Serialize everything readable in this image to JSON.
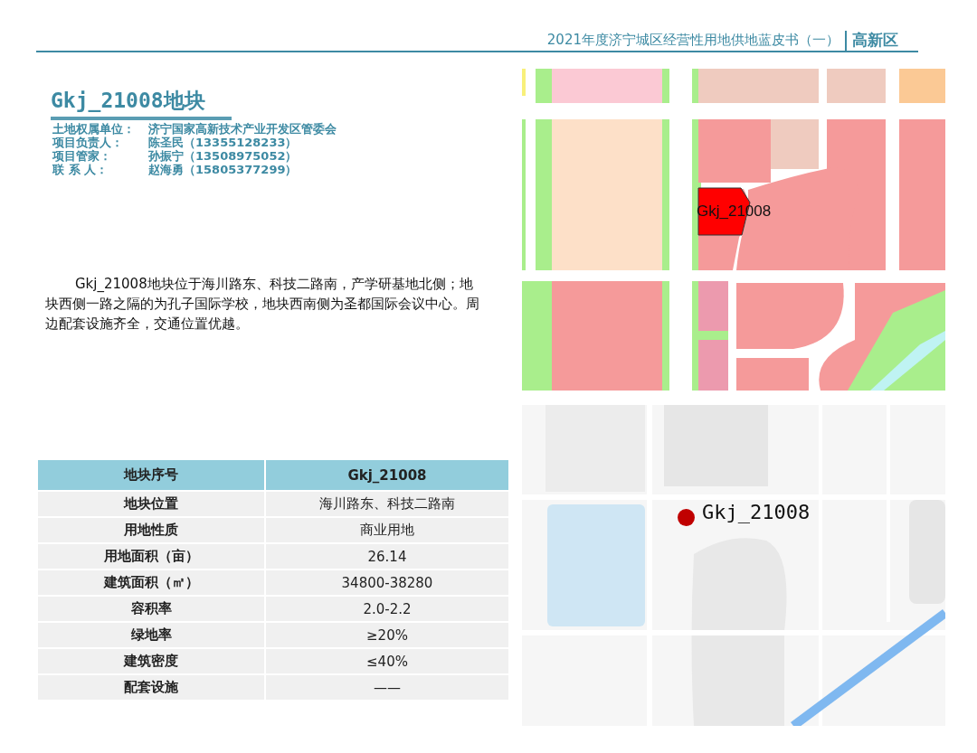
{
  "header": {
    "title": "2021年度济宁城区经营性用地供地蓝皮书（一）",
    "district": "高新区"
  },
  "parcel": {
    "title": "Gkj_21008地块",
    "info": [
      {
        "label": "土地权属单位：",
        "value": "济宁国家高新技术产业开发区管委会"
      },
      {
        "label": "项目负责人：",
        "value": "陈圣民（13355128233）"
      },
      {
        "label": "项目管家：",
        "value": "孙振宁（13508975052）"
      },
      {
        "label": "联 系 人：",
        "value": "赵海勇（15805377299）"
      }
    ],
    "description": "Gkj_21008地块位于海川路东、科技二路南，产学研基地北侧；地块西侧一路之隔的为孔子国际学校，地块西南侧为圣都国际会议中心。周边配套设施齐全，交通位置优越。"
  },
  "table": {
    "rows": [
      {
        "kind": "header",
        "label": "地块序号",
        "value": "Gkj_21008"
      },
      {
        "kind": "body",
        "label": "地块位置",
        "value": "海川路东、科技二路南"
      },
      {
        "kind": "body",
        "label": "用地性质",
        "value": "商业用地"
      },
      {
        "kind": "body",
        "label": "用地面积（亩）",
        "value": "26.14"
      },
      {
        "kind": "body",
        "label": "建筑面积（㎡）",
        "value": "34800-38280"
      },
      {
        "kind": "body",
        "label": "容积率",
        "value": "2.0-2.2"
      },
      {
        "kind": "body",
        "label": "绿地率",
        "value": "≥20%"
      },
      {
        "kind": "body",
        "label": "建筑密度",
        "value": "≤40%"
      },
      {
        "kind": "body",
        "label": "配套设施",
        "value": "——"
      }
    ]
  },
  "planning_map": {
    "plot_label": "Gkj_21008"
  },
  "location_map": {
    "marker_label": "Gkj_21008"
  }
}
